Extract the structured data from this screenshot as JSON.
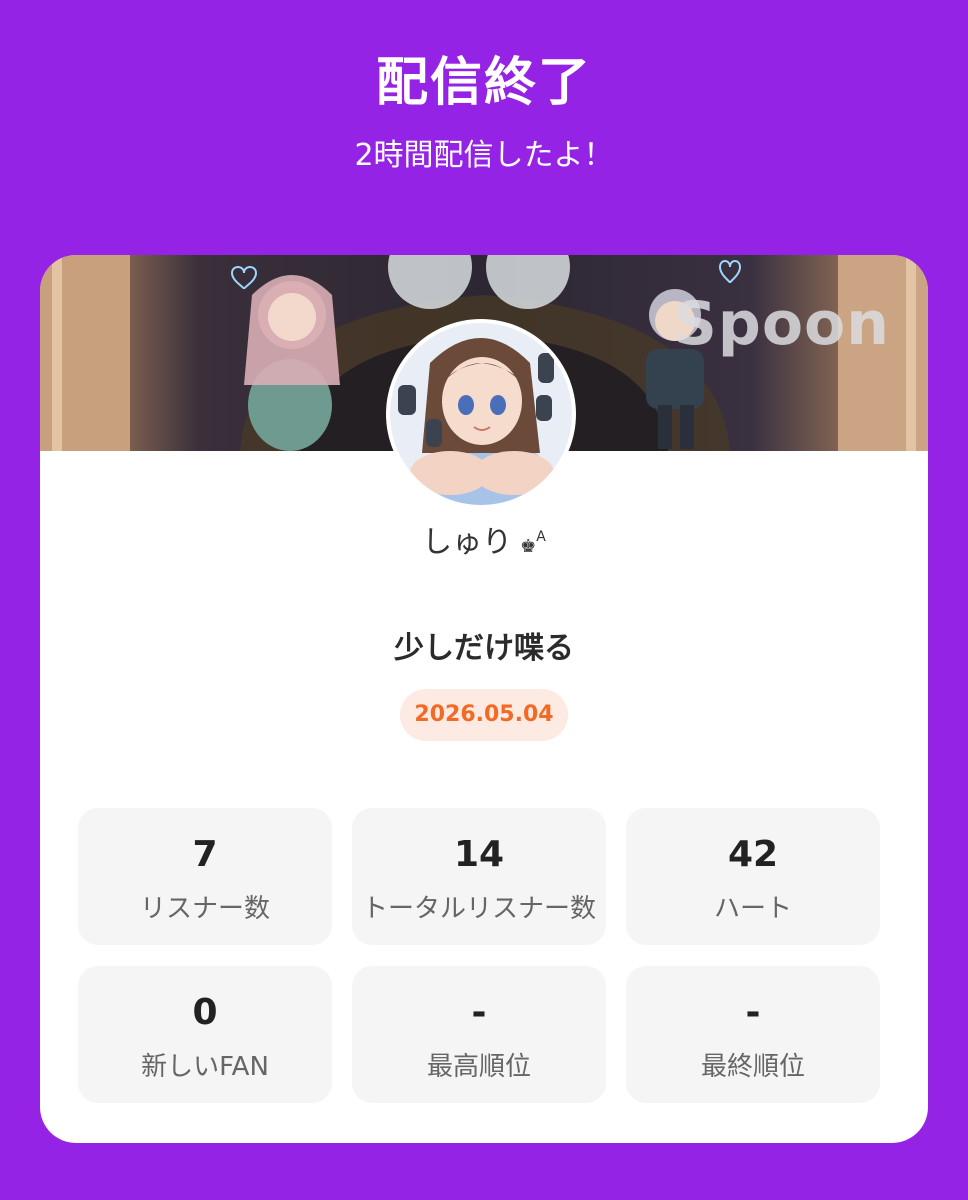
{
  "header": {
    "title": "配信終了",
    "subtitle": "2時間配信したよ！"
  },
  "banner": {
    "logo_text": "Spoon"
  },
  "profile": {
    "username": "しゅり",
    "badge_icon": "crown-icon",
    "badge_letter": "A"
  },
  "broadcast": {
    "title": "少しだけ喋る",
    "date": "2026.05.04"
  },
  "stats": [
    {
      "value": "7",
      "label": "リスナー数"
    },
    {
      "value": "14",
      "label": "トータルリスナー数"
    },
    {
      "value": "42",
      "label": "ハート"
    },
    {
      "value": "0",
      "label": "新しいFAN"
    },
    {
      "value": "-",
      "label": "最高順位"
    },
    {
      "value": "-",
      "label": "最終順位"
    }
  ],
  "colors": {
    "background": "#9523e6",
    "accent": "#f26a25",
    "badge_bg": "#fdeae2"
  }
}
